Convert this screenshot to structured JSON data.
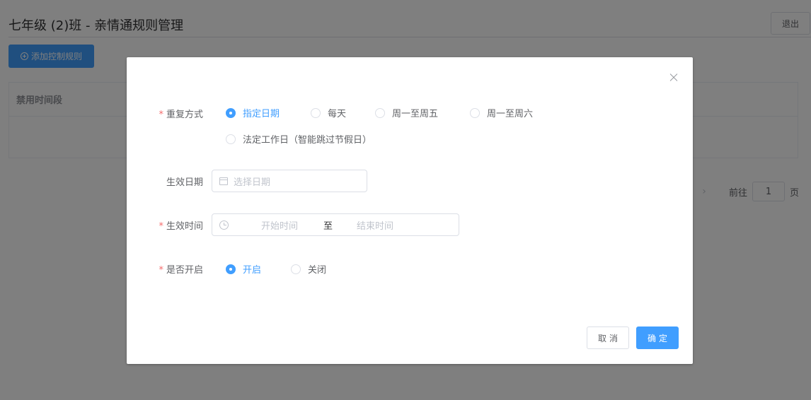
{
  "header": {
    "title": "七年级 (2)班 - 亲情通规则管理",
    "logout_label": "退出"
  },
  "toolbar": {
    "add_rule_label": "添加控制规则",
    "add_rule_icon": "plus-circle-icon"
  },
  "table": {
    "columns": [
      "禁用时间段"
    ]
  },
  "pagination": {
    "goto_label": "前往",
    "page_value": "1",
    "page_suffix": "页"
  },
  "dialog": {
    "repeat": {
      "label": "重复方式",
      "required": "*",
      "options": [
        "指定日期",
        "每天",
        "周一至周五",
        "周一至周六",
        "法定工作日（智能跳过节假日）"
      ],
      "selected": "指定日期"
    },
    "effective_date": {
      "label": "生效日期",
      "placeholder": "选择日期",
      "icon": "calendar-icon"
    },
    "effective_time": {
      "label": "生效时间",
      "required": "*",
      "start_placeholder": "开始时间",
      "separator": "至",
      "end_placeholder": "结束时间",
      "icon": "clock-icon"
    },
    "enabled": {
      "label": "是否开启",
      "required": "*",
      "options": [
        "开启",
        "关闭"
      ],
      "selected": "开启"
    },
    "buttons": {
      "cancel": "取消",
      "confirm": "确定"
    },
    "colors": {
      "primary": "#409eff",
      "required": "#f56c6c"
    }
  }
}
